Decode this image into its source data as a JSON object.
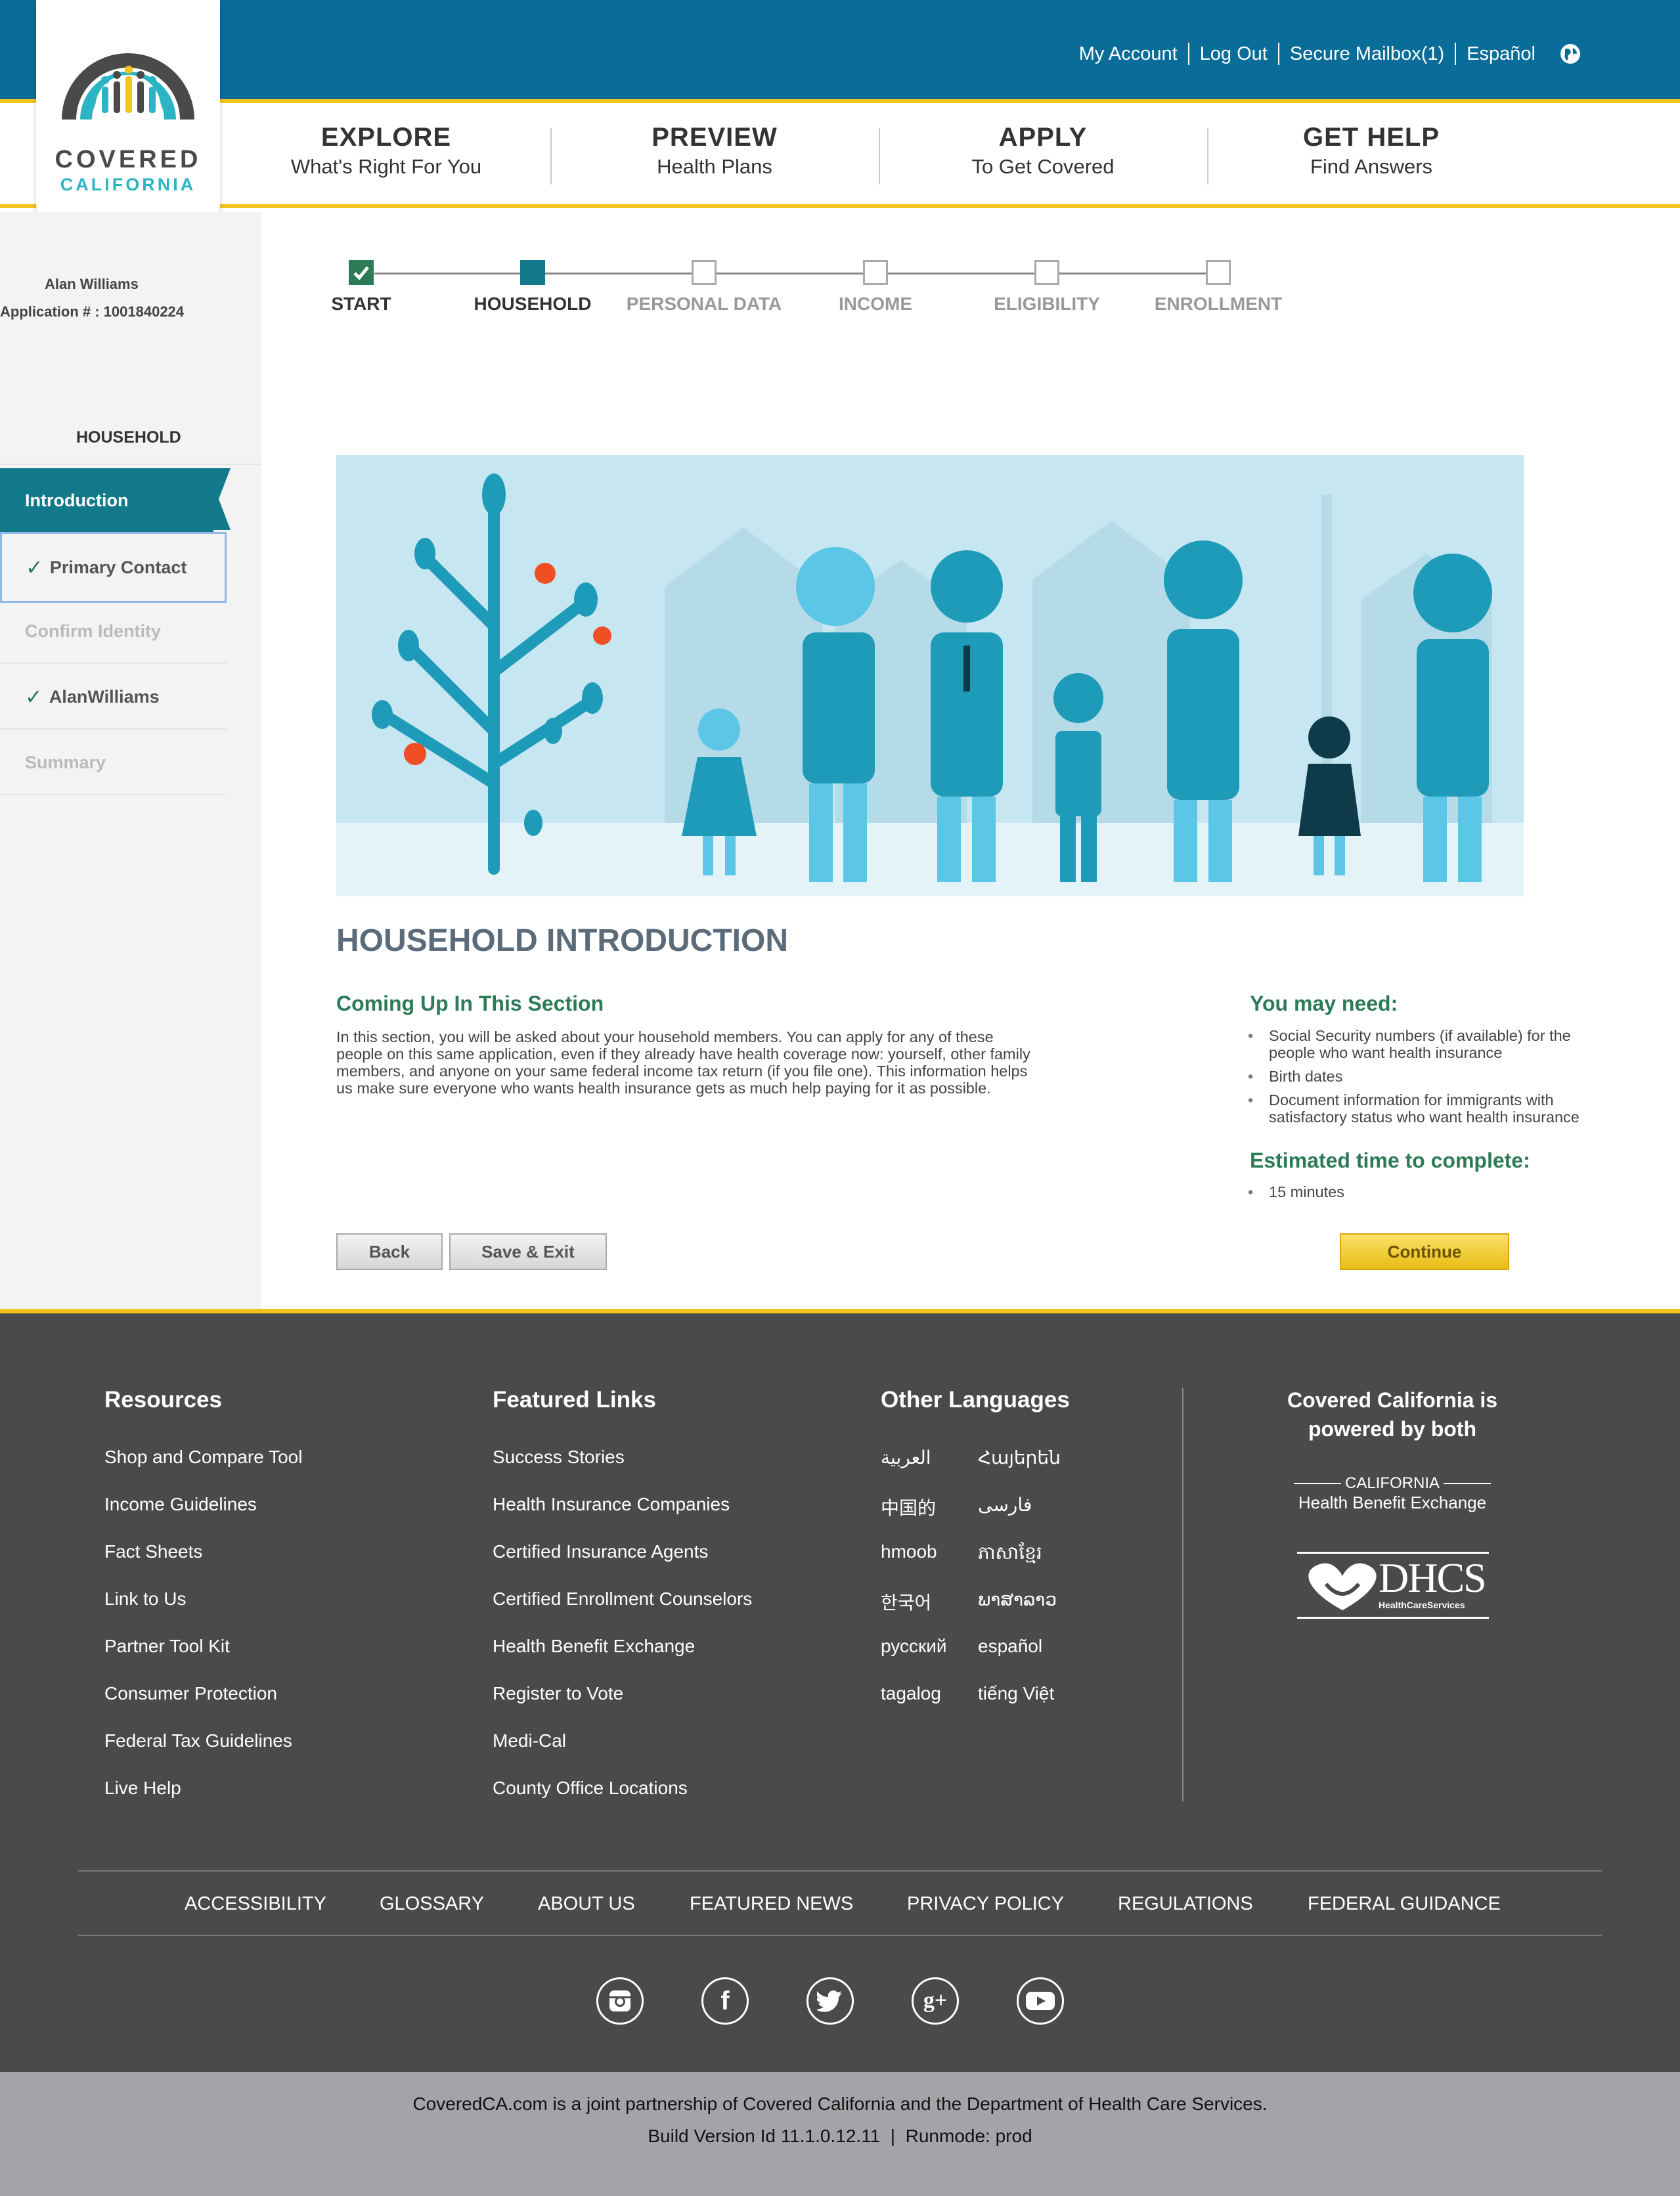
{
  "header": {
    "links": [
      "My Account",
      "Log Out",
      "Secure Mailbox(1)",
      "Español"
    ],
    "logo": {
      "line1": "COVERED",
      "line2": "CALIFORNIA"
    },
    "nav": [
      {
        "title": "EXPLORE",
        "subtitle": "What's Right For You"
      },
      {
        "title": "PREVIEW",
        "subtitle": "Health Plans"
      },
      {
        "title": "APPLY",
        "subtitle": "To Get Covered"
      },
      {
        "title": "GET HELP",
        "subtitle": "Find Answers"
      }
    ],
    "colors": {
      "brand_blue": "#0a6d99",
      "accent_yellow": "#f3c41b"
    }
  },
  "sidebar": {
    "user_name": "Alan Williams",
    "application": "Application # : 1001840224",
    "section": "HOUSEHOLD",
    "items": [
      {
        "label": "Introduction",
        "state": "active"
      },
      {
        "label": "Primary Contact",
        "state": "done"
      },
      {
        "label": "Confirm Identity",
        "state": "disabled"
      },
      {
        "label": "AlanWilliams",
        "state": "done"
      },
      {
        "label": "Summary",
        "state": "disabled"
      }
    ]
  },
  "progress": {
    "steps": [
      {
        "label": "START",
        "state": "done"
      },
      {
        "label": "HOUSEHOLD",
        "state": "current"
      },
      {
        "label": "PERSONAL DATA",
        "state": "todo"
      },
      {
        "label": "INCOME",
        "state": "todo"
      },
      {
        "label": "ELIGIBILITY",
        "state": "todo"
      },
      {
        "label": "ENROLLMENT",
        "state": "todo"
      }
    ]
  },
  "main": {
    "title": "HOUSEHOLD INTRODUCTION",
    "section_heading": "Coming Up In This Section",
    "section_text": [
      "In this section, you will be asked about your household members. You can apply for any of these",
      "people on this same application, even if they already have health coverage now: yourself, other family",
      "members, and anyone on your same federal income tax return (if you file one). This information helps",
      "us make sure everyone who wants health insurance gets as much help paying for it as possible."
    ],
    "need_heading": "You may need:",
    "need_items": [
      [
        "Social Security numbers (if available) for the",
        "people who want health insurance"
      ],
      [
        "Birth dates"
      ],
      [
        "Document information for immigrants with",
        "satisfactory status who want health insurance"
      ]
    ],
    "time_heading": "Estimated time to complete:",
    "time_value": "15 minutes",
    "buttons": {
      "back": "Back",
      "save_exit": "Save & Exit",
      "continue": "Continue"
    }
  },
  "footer": {
    "resources_heading": "Resources",
    "resources": [
      "Shop and Compare Tool",
      "Income Guidelines",
      "Fact Sheets",
      "Link to Us",
      "Partner Tool Kit",
      "Consumer Protection",
      "Federal Tax Guidelines",
      "Live Help"
    ],
    "featured_heading": "Featured Links",
    "featured": [
      "Success Stories",
      "Health Insurance Companies",
      "Certified Insurance Agents",
      "Certified Enrollment Counselors",
      "Health Benefit Exchange",
      "Register to Vote",
      "Medi-Cal",
      "County Office Locations"
    ],
    "languages_heading": "Other Languages",
    "languages": [
      [
        "العربية",
        "Հայերեն"
      ],
      [
        "中国的",
        "فارسی"
      ],
      [
        "hmoob",
        "ភាសាខ្មែរ"
      ],
      [
        "한국어",
        "ພາສາລາວ"
      ],
      [
        "русский",
        "español"
      ],
      [
        "tagalog",
        "tiếng Việt"
      ]
    ],
    "partners_heading_line1": "Covered California is",
    "partners_heading_line2": "powered by both",
    "partner1_top": "CALIFORNIA",
    "partner1_bottom": "Health Benefit Exchange",
    "partner2": "DHCS",
    "partner2_sub": "HealthCareServices",
    "bottom_links": [
      "ACCESSIBILITY",
      "GLOSSARY",
      "ABOUT US",
      "FEATURED NEWS",
      "PRIVACY POLICY",
      "REGULATIONS",
      "FEDERAL GUIDANCE"
    ],
    "social": [
      "instagram-icon",
      "facebook-icon",
      "twitter-icon",
      "google-plus-icon",
      "youtube-icon"
    ],
    "partnership_text": "CoveredCA.com is a joint partnership of Covered California and the Department of Health Care Services.",
    "build_text": "Build Version Id 11.1.0.12.11  |  Runmode: prod"
  }
}
